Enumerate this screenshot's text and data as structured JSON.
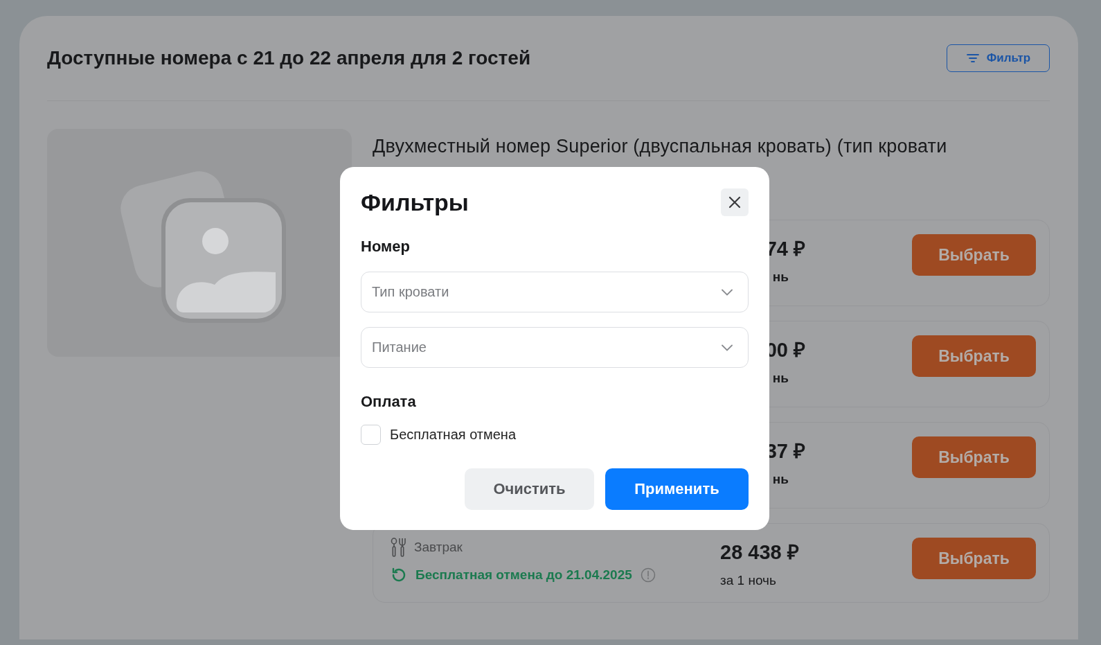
{
  "header": {
    "title": "Доступные номера с 21 до 22 апреля для 2 гостей",
    "filter_button": "Фильтр"
  },
  "room": {
    "title": "Двухместный номер Superior (двуспальная кровать) (тип кровати",
    "offers": [
      {
        "kind": "cut",
        "price": "74 ₽",
        "per_night": "нь",
        "button": "Выбрать"
      },
      {
        "kind": "cut",
        "price": "00 ₽",
        "per_night": "нь",
        "button": "Выбрать"
      },
      {
        "kind": "cut",
        "price": "37 ₽",
        "per_night": "нь",
        "button": "Выбрать"
      },
      {
        "kind": "full",
        "meal": "Завтрак",
        "cancellation": "Бесплатная отмена до 21.04.2025",
        "price": "28 438 ₽",
        "per_night": "за 1 ночь",
        "button": "Выбрать"
      }
    ]
  },
  "modal": {
    "title": "Фильтры",
    "sections": [
      {
        "heading": "Номер",
        "selects": [
          {
            "placeholder": "Тип кровати"
          },
          {
            "placeholder": "Питание"
          }
        ]
      },
      {
        "heading": "Оплата",
        "checkboxes": [
          {
            "label": "Бесплатная отмена",
            "checked": false
          }
        ]
      }
    ],
    "buttons": [
      {
        "kind": "secondary",
        "label": "Очистить"
      },
      {
        "kind": "primary",
        "label": "Применить"
      }
    ]
  }
}
